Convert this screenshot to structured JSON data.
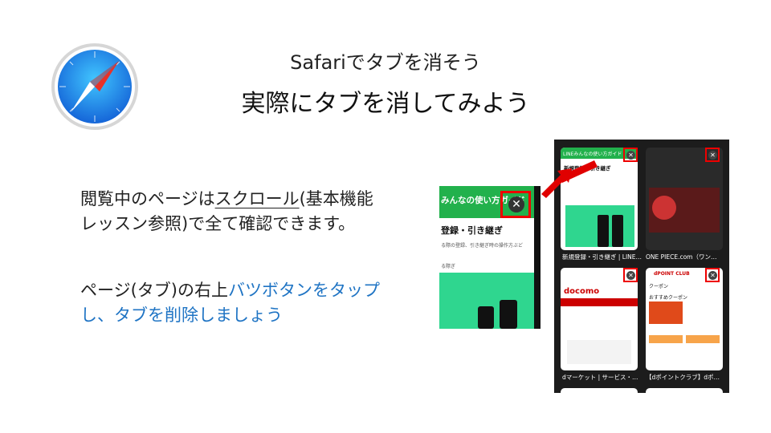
{
  "header": {
    "title": "Safariでタブを消そう",
    "subtitle": "実際にタブを消してみよう"
  },
  "body": {
    "para1": {
      "part1": "閲覧中のページは",
      "underlined": "スクロール",
      "part2": "(基本機能",
      "line2": "レッスン参照)で全て確認できます。"
    },
    "para2": {
      "part1": "ページ(タブ)の右上",
      "highlight1": "バツボタンをタップ",
      "highlight2": "し、タブを削除しましょう"
    }
  },
  "zoom": {
    "header": "みんなの使い方ガイド",
    "section": "登録・引き継ぎ",
    "desc": "る際の登録、引き継ぎ時の操作方ぶど",
    "link": "る際ぎ"
  },
  "tabs": [
    {
      "caption": "新規登録・引き継ぎ | LINE…",
      "header": "LINEみんなの使い方ガイド",
      "section": "新規登録・引き継ぎ"
    },
    {
      "caption": "ONE PIECE.com（ワン…"
    },
    {
      "caption": "dマーケット | サービス・…",
      "brand": "docomo"
    },
    {
      "caption": "【dポイントクラブ】dポ…",
      "brand": "dPOINT CLUB",
      "coupon": "クーポン",
      "coupon_title": "おすすめクーポン"
    }
  ],
  "colors": {
    "accent_blue": "#1f74c4",
    "highlight_red": "#e00000",
    "line_green": "#22b14c"
  },
  "icons": {
    "logo": "safari-compass-icon",
    "close": "close-x-icon",
    "arrow": "red-arrow-icon"
  }
}
